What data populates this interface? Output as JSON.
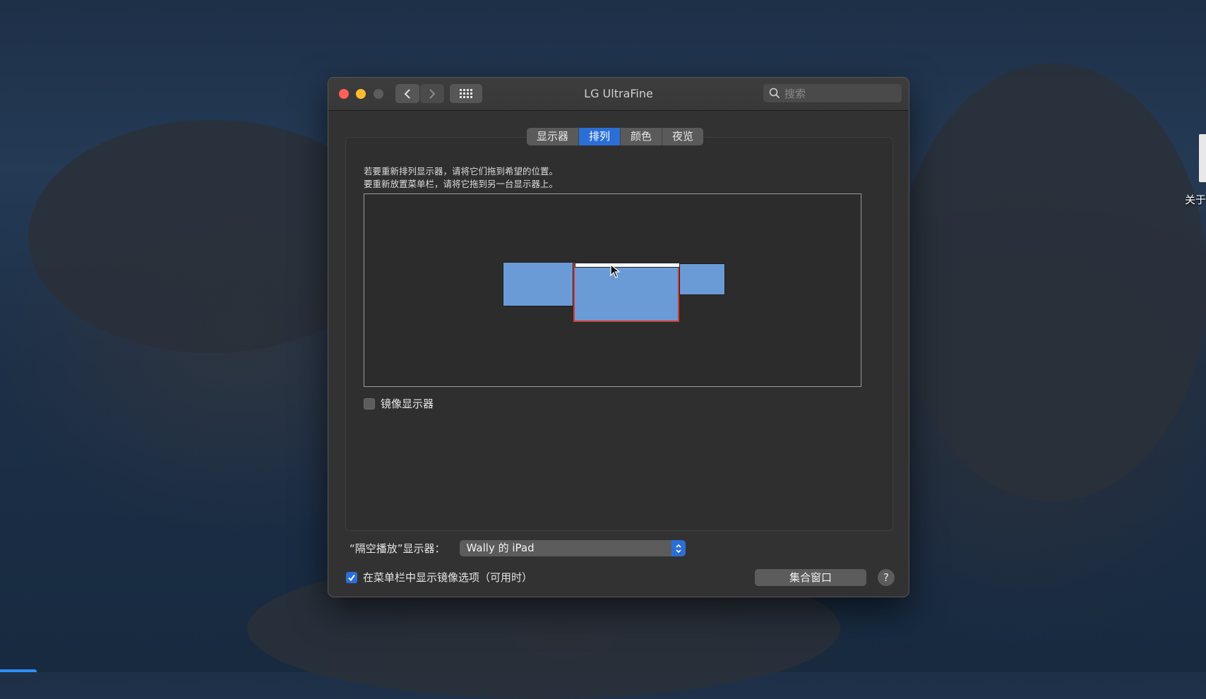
{
  "window": {
    "title": "LG UltraFine",
    "search_placeholder": "搜索"
  },
  "tabs": [
    {
      "label": "显示器",
      "active": false
    },
    {
      "label": "排列",
      "active": true
    },
    {
      "label": "颜色",
      "active": false
    },
    {
      "label": "夜览",
      "active": false
    }
  ],
  "arrangement": {
    "instruction_line1": "若要重新排列显示器，请将它们拖到希望的位置。",
    "instruction_line2": "要重新放置菜单栏，请将它拖到另一台显示器上。"
  },
  "mirror": {
    "label": "镜像显示器",
    "checked": false
  },
  "airplay": {
    "label": "“隔空播放”显示器：",
    "selected_value": "Wally 的 iPad"
  },
  "menu_option": {
    "label": "在菜单栏中显示镜像选项（可用时）",
    "checked": true
  },
  "buttons": {
    "gather_windows": "集合窗口",
    "help": "?"
  },
  "desktop": {
    "item_label": "关于"
  },
  "colors": {
    "accent": "#2b6fd6",
    "display_fill": "#6a9bd6",
    "selected_display_border": "#d63b2c"
  }
}
